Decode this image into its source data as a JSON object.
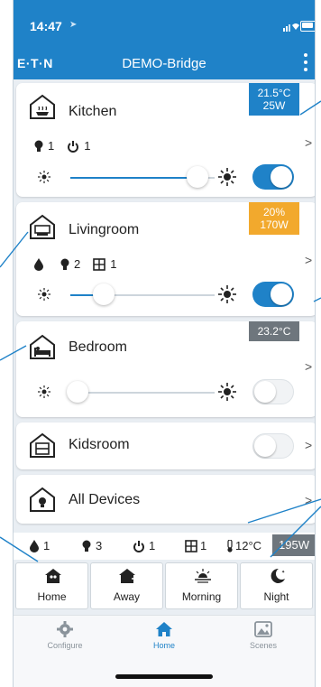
{
  "status_bar": {
    "time": "14:47"
  },
  "header": {
    "logo": "E·T·N",
    "title": "DEMO-Bridge"
  },
  "rooms": [
    {
      "name": "Kitchen",
      "badge_line1": "21.5°C",
      "badge_line2": "25W",
      "badge_color": "#1f82c8",
      "chips": [
        {
          "icon": "bulb-icon",
          "count": "1"
        },
        {
          "icon": "power-icon",
          "count": "1"
        }
      ],
      "dimmer_level": 0.88,
      "switch_on": true
    },
    {
      "name": "Livingroom",
      "badge_line1": "20%",
      "badge_line2": "170W",
      "badge_color": "#f2a92d",
      "chips": [
        {
          "icon": "drop-icon",
          "count": ""
        },
        {
          "icon": "bulb-icon",
          "count": "2"
        },
        {
          "icon": "window-icon",
          "count": "1"
        }
      ],
      "dimmer_level": 0.23,
      "switch_on": true
    },
    {
      "name": "Bedroom",
      "badge_line1": "23.2°C",
      "badge_color": "#6e767d",
      "dimmer_level": 0.05,
      "switch_on": false
    },
    {
      "name": "Kidsroom",
      "switch_on": false
    },
    {
      "name": "All Devices"
    }
  ],
  "summary": {
    "drop_count": "1",
    "bulb_count": "3",
    "power_count": "1",
    "window_count": "1",
    "temperature": "12°C",
    "power_total": "195W"
  },
  "scenes": [
    {
      "label": "Home",
      "icon": "home-scene-icon"
    },
    {
      "label": "Away",
      "icon": "away-scene-icon"
    },
    {
      "label": "Morning",
      "icon": "sunrise-icon"
    },
    {
      "label": "Night",
      "icon": "moon-icon"
    }
  ],
  "tabs": [
    {
      "label": "Configure",
      "icon": "gear-icon"
    },
    {
      "label": "Home",
      "icon": "house-icon",
      "active": true
    },
    {
      "label": "Scenes",
      "icon": "image-icon"
    }
  ],
  "colors": {
    "primary": "#1f82c8",
    "amber": "#f2a92d",
    "grey_badge": "#6e767d",
    "background": "#e9eef3"
  }
}
